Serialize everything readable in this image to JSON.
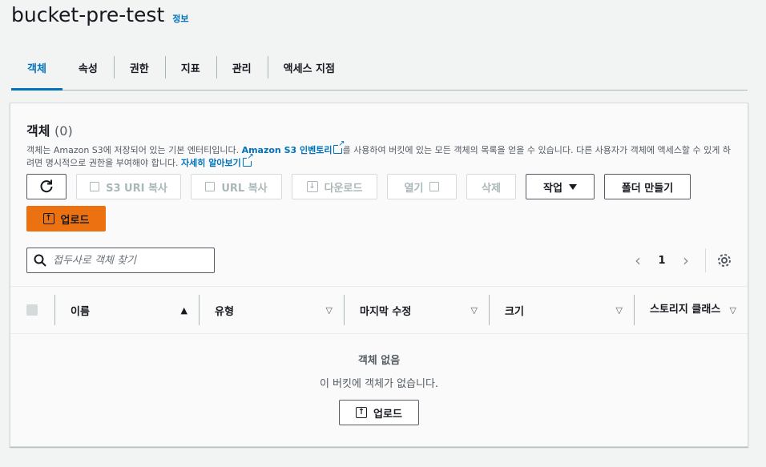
{
  "header": {
    "title": "bucket-pre-test",
    "info_label": "정보"
  },
  "tabs": [
    {
      "label": "객체",
      "active": true
    },
    {
      "label": "속성"
    },
    {
      "label": "권한"
    },
    {
      "label": "지표"
    },
    {
      "label": "관리"
    },
    {
      "label": "액세스 지점"
    }
  ],
  "panel": {
    "title": "객체",
    "count": "(0)",
    "desc_part1": "객체는 Amazon S3에 저장되어 있는 기본 엔터티입니다. ",
    "desc_link1": "Amazon S3 인벤토리",
    "desc_part2": "를 사용하여 버킷에 있는 모든 객체의 목록을 얻을 수 있습니다. 다른 사용자가 객체에 액세스할 수 있게 하려면 명시적으로 권한을 부여해야 합니다. ",
    "desc_link2": "자세히 알아보기"
  },
  "toolbar": {
    "refresh_icon": "refresh-icon",
    "copy_s3_uri": "S3 URI 복사",
    "copy_url": "URL 복사",
    "download": "다운로드",
    "open": "열기",
    "delete": "삭제",
    "actions": "작업",
    "create_folder": "폴더 만들기",
    "upload": "업로드"
  },
  "search": {
    "placeholder": "접두사로 객체 찾기"
  },
  "pagination": {
    "current_page": "1"
  },
  "table": {
    "columns": [
      "이름",
      "유형",
      "마지막 수정",
      "크기",
      "스토리지 클래스"
    ]
  },
  "empty_state": {
    "title": "객체 없음",
    "message": "이 버킷에 객체가 없습니다.",
    "upload_label": "업로드"
  },
  "colors": {
    "accent": "#0073bb",
    "primary_button": "#ec7211"
  }
}
